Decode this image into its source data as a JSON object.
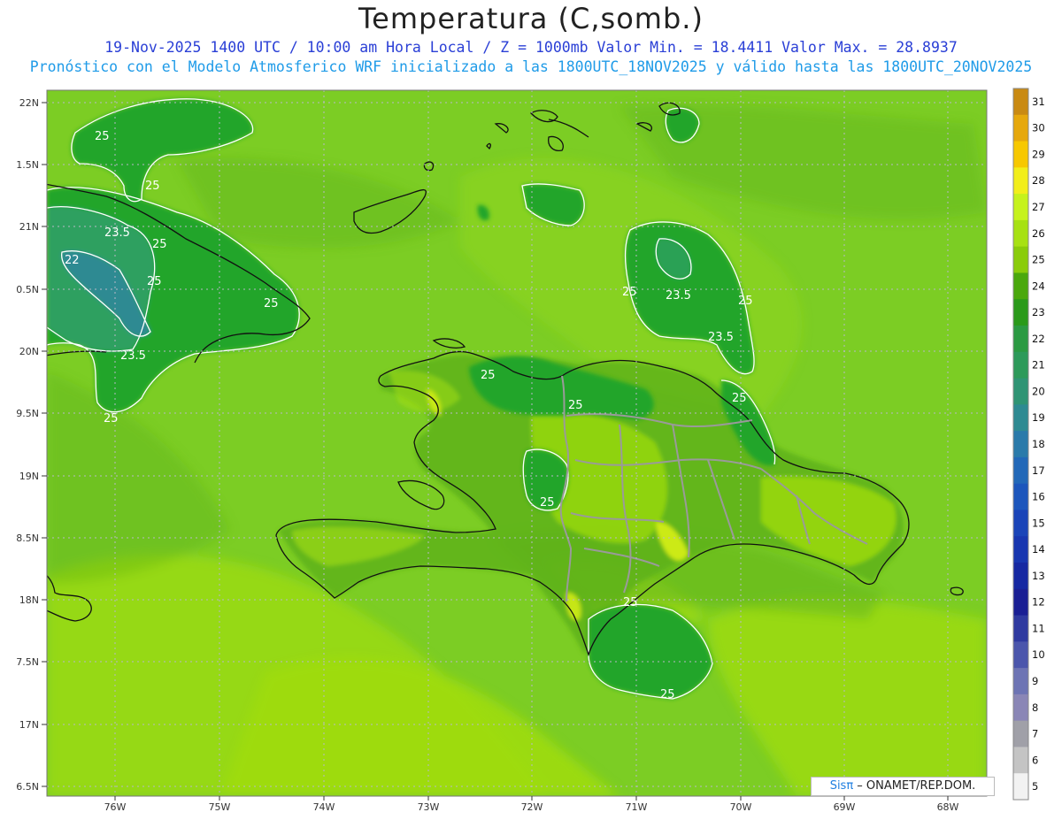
{
  "header": {
    "title": "Temperatura (C,somb.)",
    "subtitle_1": "19-Nov-2025 1400 UTC / 10:00 am Hora Local / Z = 1000mb   Valor Min. = 18.4411  Valor Max. = 28.8937",
    "subtitle_2": "Pronóstico con el Modelo Atmosferico WRF inicializado a las 1800UTC_18NOV2025 y válido hasta las  1800UTC_20NOV2025"
  },
  "axes": {
    "lat_labels": [
      "22N",
      "1.5N",
      "21N",
      "0.5N",
      "20N",
      "9.5N",
      "19N",
      "8.5N",
      "18N",
      "7.5N",
      "17N",
      "6.5N"
    ],
    "lon_labels": [
      "76W",
      "75W",
      "74W",
      "73W",
      "72W",
      "71W",
      "70W",
      "69W",
      "68W"
    ]
  },
  "contour_labels": [
    {
      "text": "25"
    },
    {
      "text": "25"
    },
    {
      "text": "23.5"
    },
    {
      "text": "25"
    },
    {
      "text": "22"
    },
    {
      "text": "25"
    },
    {
      "text": "25"
    },
    {
      "text": "23.5"
    },
    {
      "text": "25"
    },
    {
      "text": "25"
    },
    {
      "text": "25"
    },
    {
      "text": "25"
    },
    {
      "text": "25"
    },
    {
      "text": "23.5"
    },
    {
      "text": "25"
    },
    {
      "text": "23.5"
    },
    {
      "text": "25"
    },
    {
      "text": "25"
    },
    {
      "text": "25"
    }
  ],
  "colorbar": {
    "labels": [
      "31",
      "30",
      "29",
      "28",
      "27",
      "26",
      "25",
      "24",
      "23",
      "22",
      "21",
      "20",
      "19",
      "18",
      "17",
      "16",
      "15",
      "14",
      "13",
      "12",
      "11",
      "10",
      "9",
      "8",
      "7",
      "6",
      "5"
    ],
    "colors": [
      "#c98a12",
      "#e6a80c",
      "#f7c800",
      "#f2ee1a",
      "#c6f21c",
      "#a7e112",
      "#8acc0a",
      "#4aa80c",
      "#2a9a1a",
      "#2b9a42",
      "#2d9a5a",
      "#2f9474",
      "#2e8a92",
      "#2a7aaa",
      "#2268b8",
      "#1c56bc",
      "#1a44b8",
      "#1836b0",
      "#1628a2",
      "#1a1f94",
      "#2f3aa0",
      "#4b56ac",
      "#6d74b4",
      "#8a86b6",
      "#a0a0a8",
      "#c4c4c4",
      "#f2f2f2"
    ]
  },
  "palette": {
    "sea_base": "#7ccd24",
    "sea_light": "#9fdc12",
    "land_dark": "#5cb018",
    "cool_zone": "#22a52c",
    "cooler_zone": "#2fa060",
    "coldest_zone": "#2e8a92",
    "warm_spot": "#d8ef1a",
    "hot_spot": "#f2ee1a"
  },
  "credit": {
    "brand": "Sisπ",
    "text": " – ONAMET/REP.DOM."
  }
}
